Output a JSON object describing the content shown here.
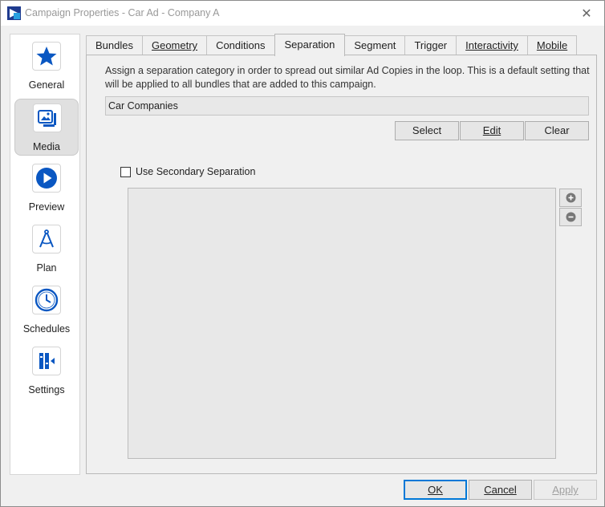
{
  "window": {
    "title": "Campaign Properties - Car Ad - Company A",
    "close_glyph": "✕"
  },
  "sidebar": {
    "items": [
      {
        "label": "General",
        "icon": "star-icon",
        "active": false
      },
      {
        "label": "Media",
        "icon": "media-icon",
        "active": true
      },
      {
        "label": "Preview",
        "icon": "play-icon",
        "active": false
      },
      {
        "label": "Plan",
        "icon": "compass-icon",
        "active": false
      },
      {
        "label": "Schedules",
        "icon": "clock-icon",
        "active": false
      },
      {
        "label": "Settings",
        "icon": "settings-icon",
        "active": false
      }
    ]
  },
  "tabs": [
    {
      "label": "Bundles",
      "active": false
    },
    {
      "label": "Geometry",
      "active": false
    },
    {
      "label": "Conditions",
      "active": false
    },
    {
      "label": "Separation",
      "active": true
    },
    {
      "label": "Segment",
      "active": false
    },
    {
      "label": "Trigger",
      "active": false
    },
    {
      "label": "Interactivity",
      "active": false
    },
    {
      "label": "Mobile",
      "active": false
    }
  ],
  "separation": {
    "description": "Assign a separation category in order to spread out similar Ad Copies in the loop. This is a default setting that will be applied to all bundles that are added to this campaign.",
    "category_value": "Car Companies",
    "select_label": "Select",
    "edit_label": "Edit",
    "clear_label": "Clear",
    "secondary_checkbox_label": "Use Secondary Separation",
    "secondary_checked": false
  },
  "footer": {
    "ok_label": "OK",
    "cancel_label": "Cancel",
    "apply_label": "Apply"
  },
  "colors": {
    "accent": "#0a57c2",
    "window_bg": "#f0f0f0"
  }
}
